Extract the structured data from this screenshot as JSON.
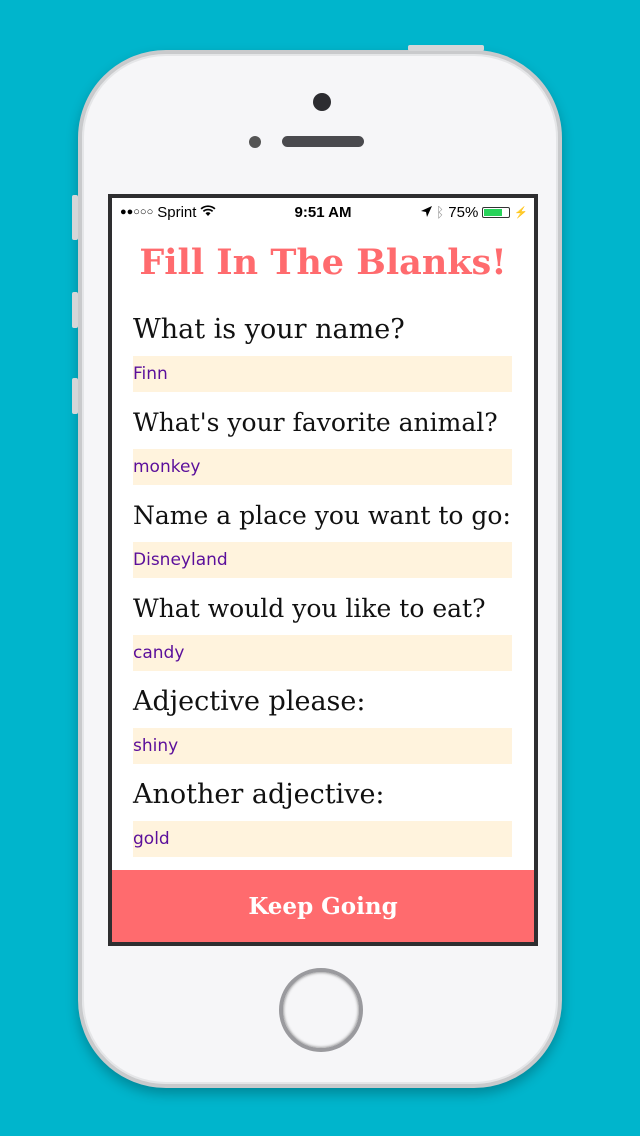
{
  "status_bar": {
    "signal": "●●○○○",
    "carrier": "Sprint",
    "time": "9:51 AM",
    "battery": "75%",
    "battery_level": 0.75
  },
  "app": {
    "title": "Fill In The Blanks!"
  },
  "fields": [
    {
      "label": "What is your name?",
      "value": "Finn"
    },
    {
      "label": "What's your favorite animal?",
      "value": "monkey"
    },
    {
      "label": "Name a place you want to go:",
      "value": "Disneyland"
    },
    {
      "label": "What would you like to eat?",
      "value": "candy"
    },
    {
      "label": "Adjective please:",
      "value": "shiny"
    },
    {
      "label": "Another adjective:",
      "value": "gold"
    }
  ],
  "button": {
    "label": "Keep Going"
  },
  "colors": {
    "background": "#00b5cc",
    "accent": "#ff6b6e",
    "input_bg": "#fff3dd",
    "input_text": "#5b0f9b"
  }
}
